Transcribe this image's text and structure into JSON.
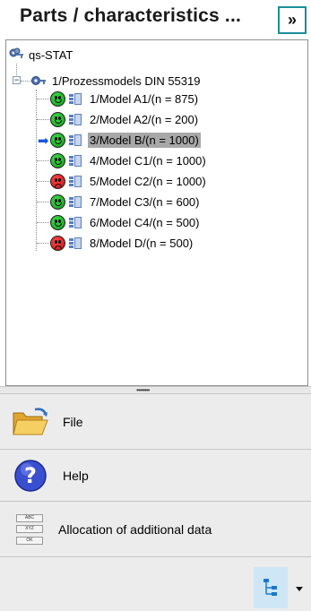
{
  "header": {
    "title": "Parts / characteristics ...",
    "collapse_label": "»"
  },
  "tree": {
    "root_label": "qs-STAT",
    "group_label": "1/Prozessmodels DIN 55319",
    "expander_symbol": "−",
    "current_indicator": "➡",
    "items": [
      {
        "label": "1/Model A1/(n = 875)",
        "status": "good",
        "selected": false
      },
      {
        "label": "2/Model A2/(n = 200)",
        "status": "good",
        "selected": false
      },
      {
        "label": "3/Model B/(n = 1000)",
        "status": "good",
        "selected": true
      },
      {
        "label": "4/Model C1/(n = 1000)",
        "status": "good",
        "selected": false
      },
      {
        "label": "5/Model C2/(n = 1000)",
        "status": "bad",
        "selected": false
      },
      {
        "label": "7/Model C3/(n = 600)",
        "status": "good",
        "selected": false
      },
      {
        "label": "6/Model C4/(n = 500)",
        "status": "good",
        "selected": false
      },
      {
        "label": "8/Model D/(n = 500)",
        "status": "bad",
        "selected": false
      }
    ]
  },
  "splitter": {
    "grip": "••••••••"
  },
  "nav": {
    "file_label": "File",
    "help_label": "Help",
    "allocation_label": "Allocation of additional data",
    "allocation_icon_text": [
      "ABC",
      "XYZ",
      "OK"
    ]
  },
  "colors": {
    "accent": "#1c8e9a",
    "selection": "#a8a8a8",
    "status_good": "#1fb82a",
    "status_bad": "#e01818"
  },
  "icons": {
    "collapse": "double-chevron-right-icon",
    "root": "keys-icon",
    "group": "key-icon",
    "good": "green-smiley-icon",
    "bad": "red-frown-icon",
    "model": "model-icon",
    "file": "folder-open-icon",
    "help": "help-question-icon",
    "allocation": "abc-xyz-ok-icon",
    "tree_view": "tree-view-icon",
    "dropdown": "dropdown-arrow-icon"
  }
}
